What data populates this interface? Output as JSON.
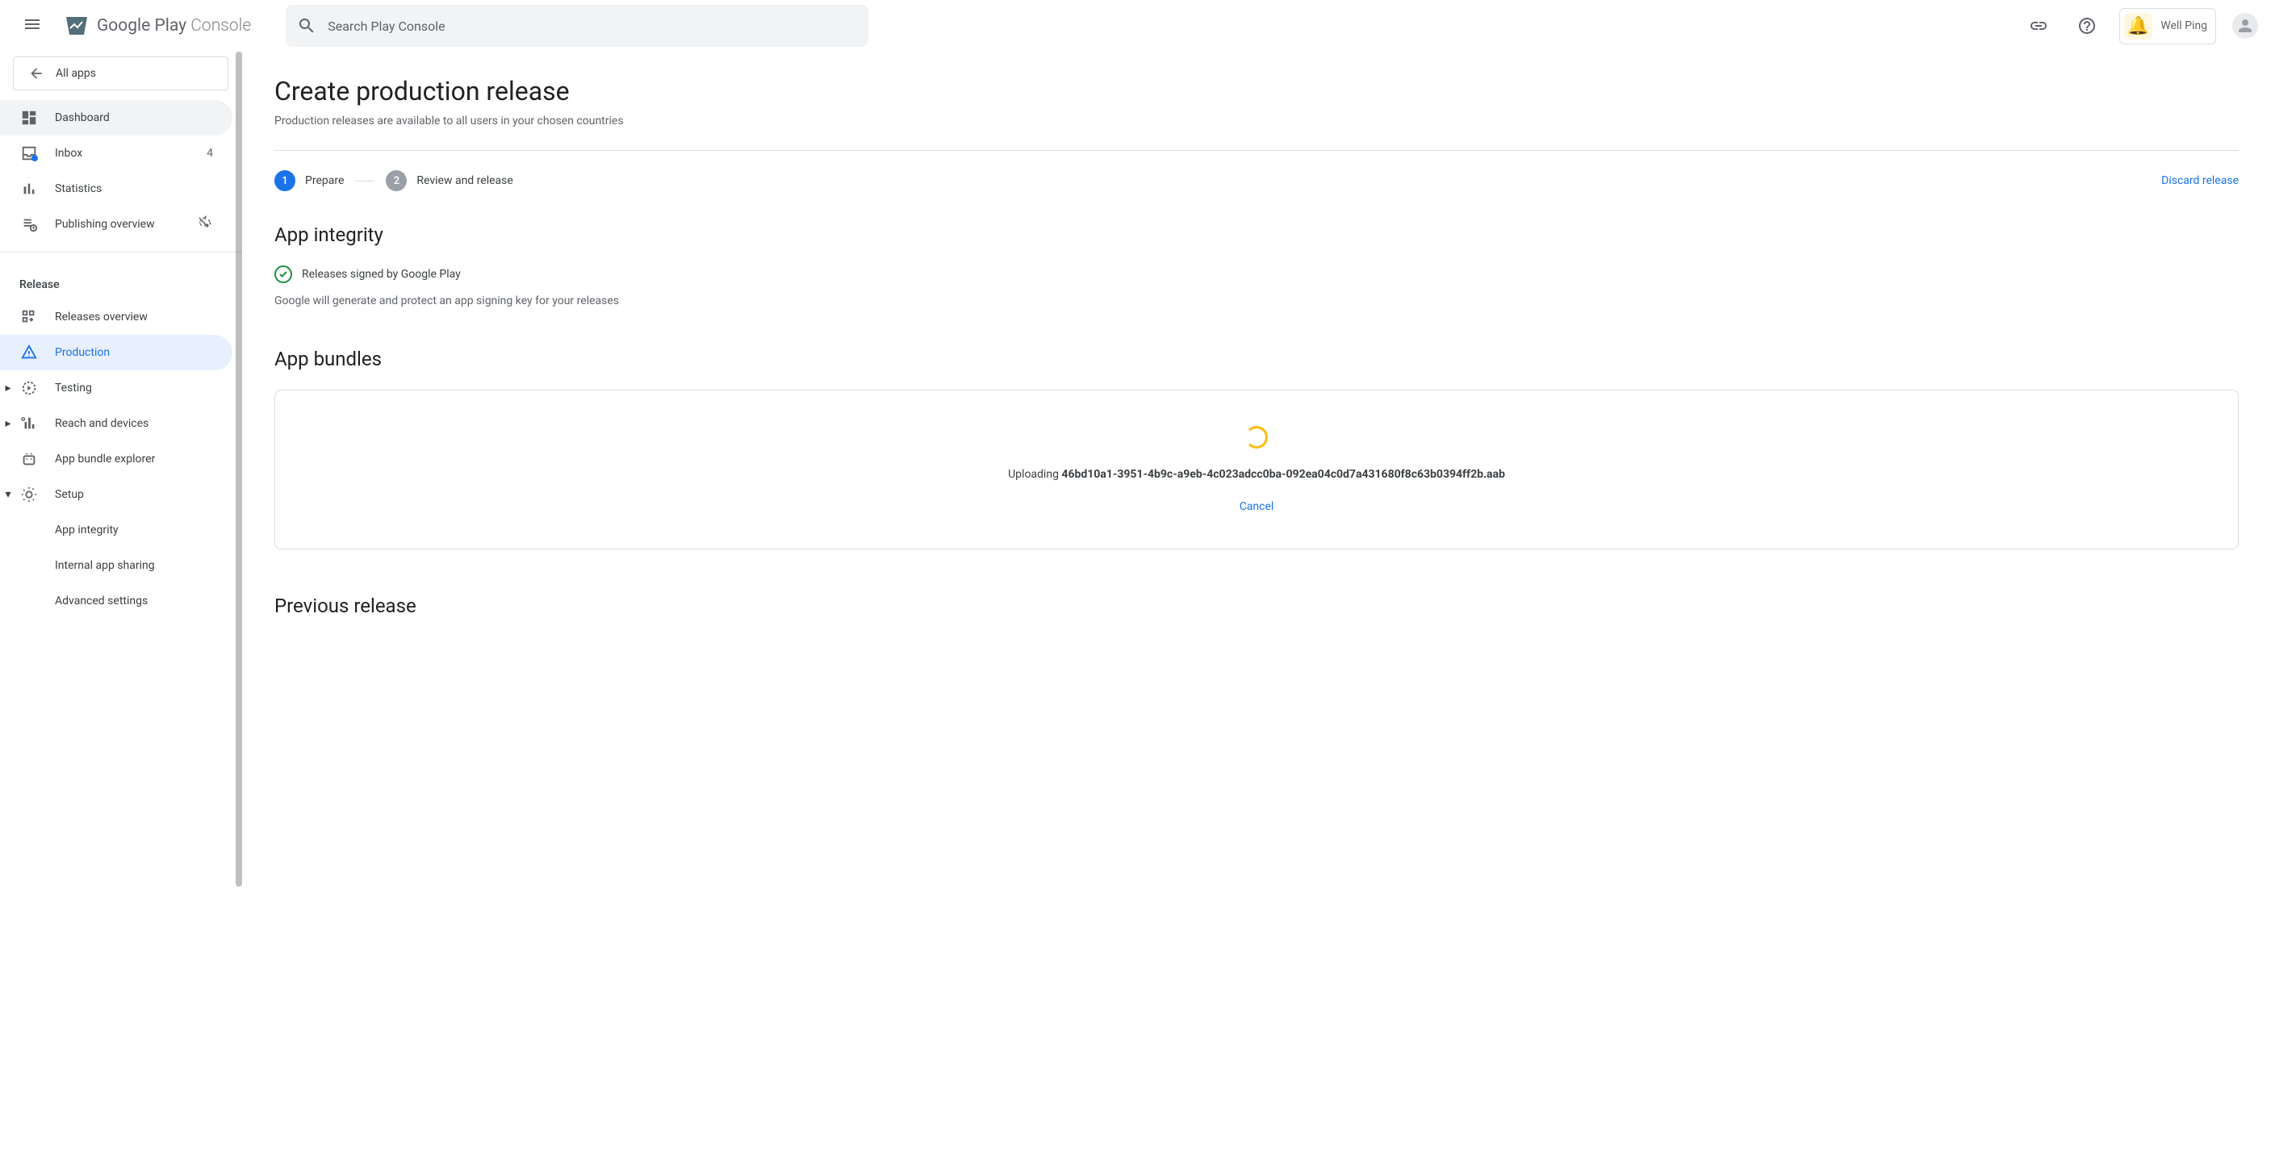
{
  "header": {
    "logo_text_1": "Google Play",
    "logo_text_2": "Console",
    "search_placeholder": "Search Play Console",
    "user_name": "Well Ping"
  },
  "sidebar": {
    "all_apps": "All apps",
    "dashboard": "Dashboard",
    "inbox": "Inbox",
    "inbox_badge": "4",
    "statistics": "Statistics",
    "publishing_overview": "Publishing overview",
    "section_release": "Release",
    "releases_overview": "Releases overview",
    "production": "Production",
    "testing": "Testing",
    "reach_devices": "Reach and devices",
    "app_bundle_explorer": "App bundle explorer",
    "setup": "Setup",
    "setup_app_integrity": "App integrity",
    "setup_internal_sharing": "Internal app sharing",
    "setup_advanced": "Advanced settings"
  },
  "main": {
    "title": "Create production release",
    "subtitle": "Production releases are available to all users in your chosen countries",
    "step1_num": "1",
    "step1_label": "Prepare",
    "step2_num": "2",
    "step2_label": "Review and release",
    "discard": "Discard release",
    "integrity_title": "App integrity",
    "integrity_signed": "Releases signed by Google Play",
    "integrity_desc": "Google will generate and protect an app signing key for your releases",
    "bundles_title": "App bundles",
    "uploading_prefix": "Uploading ",
    "uploading_file": "46bd10a1-3951-4b9c-a9eb-4c023adcc0ba-092ea04c0d7a431680f8c63b0394ff2b.aab",
    "cancel": "Cancel",
    "previous_release": "Previous release"
  }
}
